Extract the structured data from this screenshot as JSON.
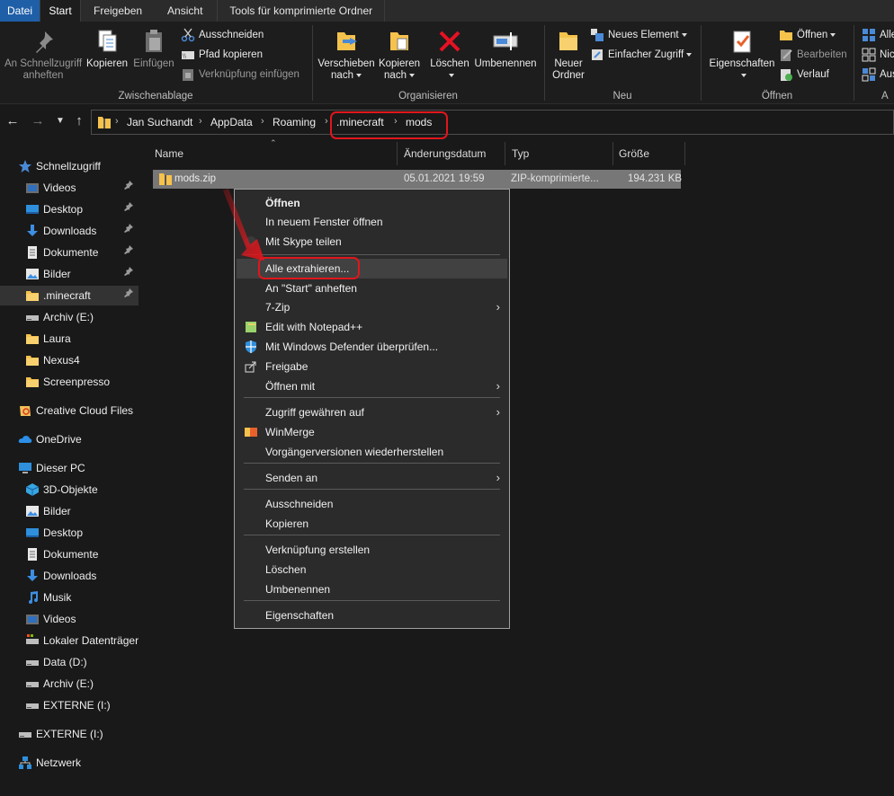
{
  "ribbon_tabs": [
    "Datei",
    "Start",
    "Freigeben",
    "Ansicht",
    "Tools für komprimierte Ordner"
  ],
  "ribbon": {
    "clipboard": {
      "label": "Zwischenablage",
      "pin_quick": "An Schnellzugriff anheften",
      "pin_quick_l1": "An Schnellzugriff",
      "pin_quick_l2": "anheften",
      "copy": "Kopieren",
      "paste": "Einfügen",
      "cut": "Ausschneiden",
      "copy_path": "Pfad kopieren",
      "paste_shortcut": "Verknüpfung einfügen"
    },
    "organize": {
      "label": "Organisieren",
      "move_l1": "Verschieben",
      "move_l2": "nach",
      "copy_l1": "Kopieren",
      "copy_l2": "nach",
      "delete": "Löschen",
      "rename": "Umbenennen"
    },
    "new": {
      "label": "Neu",
      "new_folder_l1": "Neuer",
      "new_folder_l2": "Ordner",
      "new_item": "Neues Element",
      "easy_access": "Einfacher Zugriff"
    },
    "open": {
      "label": "Öffnen",
      "properties": "Eigenschaften",
      "open": "Öffnen",
      "edit": "Bearbeiten",
      "history": "Verlauf"
    },
    "select": {
      "all": "Alle",
      "none": "Nic",
      "invert": "Aus",
      "label_fragment": "A"
    }
  },
  "address": {
    "crumbs": [
      "Jan Suchandt",
      "AppData",
      "Roaming",
      ".minecraft",
      "mods"
    ]
  },
  "sidebar": {
    "items": [
      {
        "label": "Schnellzugriff",
        "icon": "star-icon"
      },
      {
        "label": "Videos",
        "icon": "videos-folder-icon",
        "pinned": true
      },
      {
        "label": "Desktop",
        "icon": "desktop-folder-icon",
        "pinned": true
      },
      {
        "label": "Downloads",
        "icon": "downloads-icon",
        "pinned": true
      },
      {
        "label": "Dokumente",
        "icon": "documents-folder-icon",
        "pinned": true
      },
      {
        "label": "Bilder",
        "icon": "pictures-folder-icon",
        "pinned": true
      },
      {
        "label": ".minecraft",
        "icon": "folder-icon",
        "pinned": true,
        "selected": true
      },
      {
        "label": "Archiv (E:)",
        "icon": "drive-icon"
      },
      {
        "label": "Laura",
        "icon": "folder-icon"
      },
      {
        "label": "Nexus4",
        "icon": "folder-icon"
      },
      {
        "label": "Screenpresso",
        "icon": "folder-icon"
      },
      {
        "label": "Creative Cloud Files",
        "icon": "creative-cloud-icon"
      },
      {
        "label": "OneDrive",
        "icon": "onedrive-cloud-icon"
      },
      {
        "label": "Dieser PC",
        "icon": "computer-icon"
      },
      {
        "label": "3D-Objekte",
        "icon": "3d-objects-icon"
      },
      {
        "label": "Bilder",
        "icon": "pictures-folder-icon"
      },
      {
        "label": "Desktop",
        "icon": "desktop-folder-icon"
      },
      {
        "label": "Dokumente",
        "icon": "documents-folder-icon"
      },
      {
        "label": "Downloads",
        "icon": "downloads-icon"
      },
      {
        "label": "Musik",
        "icon": "music-icon"
      },
      {
        "label": "Videos",
        "icon": "videos-folder-icon"
      },
      {
        "label": "Lokaler Datenträger",
        "icon": "system-drive-icon"
      },
      {
        "label": "Data (D:)",
        "icon": "drive-icon"
      },
      {
        "label": "Archiv (E:)",
        "icon": "drive-icon"
      },
      {
        "label": "EXTERNE (I:)",
        "icon": "drive-icon"
      },
      {
        "label": "EXTERNE (I:)",
        "icon": "drive-icon"
      },
      {
        "label": "Netzwerk",
        "icon": "network-icon"
      }
    ]
  },
  "list": {
    "columns": [
      "Name",
      "Änderungsdatum",
      "Typ",
      "Größe"
    ],
    "rows": [
      {
        "name": "mods.zip",
        "modified": "05.01.2021 19:59",
        "type": "ZIP-komprimierte...",
        "size": "194.231 KB"
      }
    ]
  },
  "context_menu": {
    "items": [
      "Öffnen",
      "In neuem Fenster öffnen",
      "Mit Skype teilen",
      "Alle extrahieren...",
      "An \"Start\" anheften",
      "7-Zip",
      "Edit with Notepad++",
      "Mit Windows Defender überprüfen...",
      "Freigabe",
      "Öffnen mit",
      "Zugriff gewähren auf",
      "WinMerge",
      "Vorgängerversionen wiederherstellen",
      "Senden an",
      "Ausschneiden",
      "Kopieren",
      "Verknüpfung erstellen",
      "Löschen",
      "Umbenennen",
      "Eigenschaften"
    ]
  },
  "colors": {
    "accent_tab": "#1f5fa8",
    "highlight_red": "#e0161c",
    "background": "#191919"
  }
}
